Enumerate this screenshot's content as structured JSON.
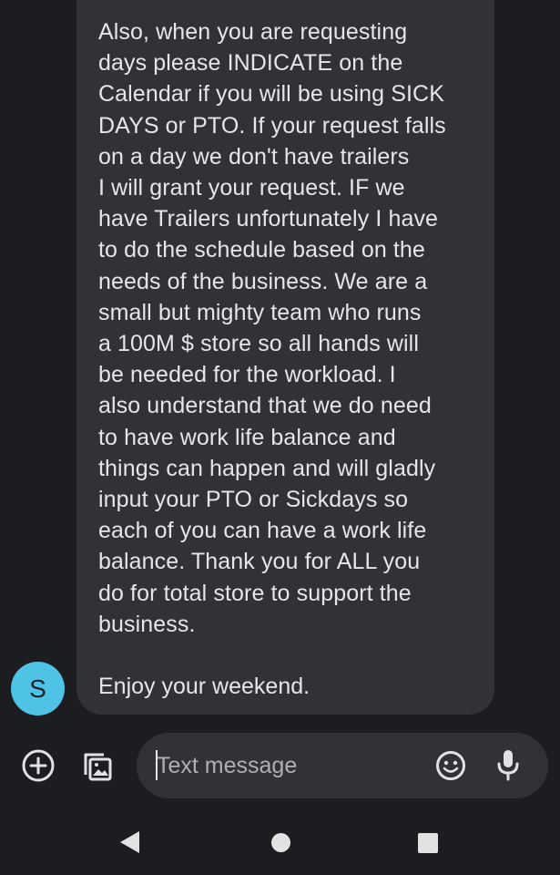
{
  "message": {
    "body": "Also, when you are requesting\ndays please INDICATE on the\nCalendar if you will be using SICK\nDAYS or PTO. If your request falls\non a day we don't have trailers\nI will grant your request. IF we\nhave Trailers unfortunately I have\nto do the schedule based on the\nneeds of the business. We are a\nsmall but mighty team who runs\na 100M $ store so all hands will\nbe needed for the workload. I\nalso understand that we do need\nto have work life balance and\nthings can happen and will gladly\ninput your PTO or Sickdays so\neach of you can have a work life\nbalance. Thank you for ALL you\ndo for total store to support the\nbusiness.",
    "closing": "Enjoy your weekend."
  },
  "sender": {
    "initial": "S",
    "avatar_color": "#4fc3e6"
  },
  "composer": {
    "placeholder": "Text message",
    "value": "",
    "icons": {
      "add": "add-circle-icon",
      "gallery": "gallery-icon",
      "emoji": "emoji-icon",
      "mic": "microphone-icon"
    }
  },
  "navigation": {
    "icons": [
      "back-icon",
      "home-icon",
      "recents-icon"
    ]
  },
  "colors": {
    "background": "#1b1d21",
    "bubble": "#303236",
    "text": "#e6e6e8",
    "placeholder": "#aeb0b4"
  }
}
